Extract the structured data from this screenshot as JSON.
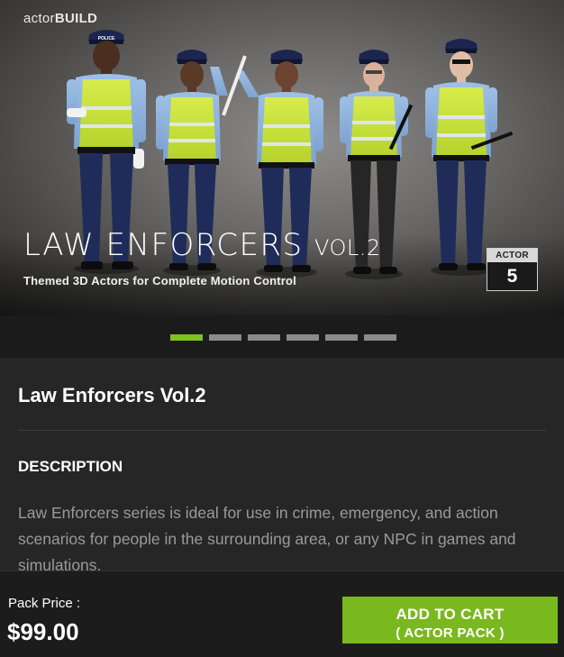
{
  "hero": {
    "brand_prefix": "actor",
    "brand_suffix": "BUILD",
    "title_main": "LAW ENFORCERS",
    "title_vol": "VOL.2",
    "subtitle": "Themed 3D Actors for Complete Motion Control",
    "badge_label": "ACTOR",
    "badge_count": "5",
    "figure_hat_text": "POLICE"
  },
  "carousel": {
    "slide_count": 6,
    "active_index": 0
  },
  "product": {
    "title": "Law Enforcers Vol.2",
    "description_heading": "DESCRIPTION",
    "description": "Law Enforcers series is ideal for use in crime, emergency, and action scenarios for people in the surrounding area, or any NPC in games and simulations."
  },
  "footer": {
    "price_label": "Pack Price :",
    "price": "$99.00",
    "cart_line1": "ADD TO CART",
    "cart_line2": "( ACTOR PACK )"
  },
  "colors": {
    "accent": "#7ab81f",
    "dot_active": "#7dc21f",
    "vest": "#c8e03a",
    "uniform_shirt": "#8fb4df",
    "trousers": "#1f2c5a"
  }
}
